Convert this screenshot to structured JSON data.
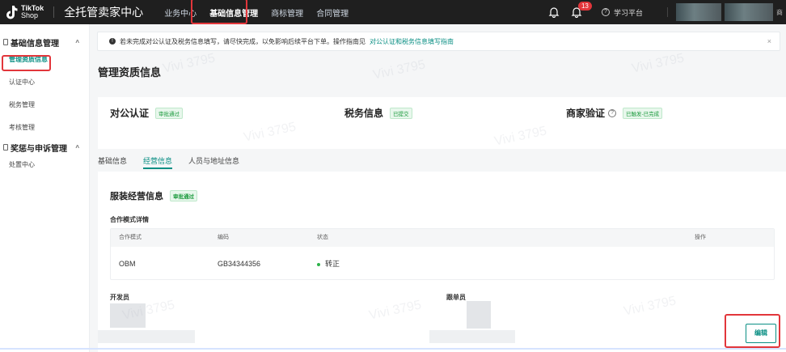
{
  "topbar": {
    "logo_line1": "TikTok",
    "logo_line2": "Shop",
    "brand": "全托管卖家中心",
    "nav": [
      "业务中心",
      "基础信息管理",
      "商标管理",
      "合同管理"
    ],
    "notification_count": "13",
    "help_label": "学习平台",
    "extra_text": "商"
  },
  "sidebar": {
    "group1": "基础信息管理",
    "items1": [
      "管理资质信息",
      "认证中心",
      "税务管理",
      "考核管理"
    ],
    "group2": "奖惩与申诉管理",
    "items2": [
      "处置中心"
    ]
  },
  "notice": {
    "text": "若未完成对公认证及税务信息填写，请尽快完成，以免影响后续平台下单。操作指南见",
    "link": "对公认证和税务信息填写指南"
  },
  "page": {
    "title": "管理资质信息"
  },
  "status": [
    {
      "label": "对公认证",
      "tag": "审批通过"
    },
    {
      "label": "税务信息",
      "tag": "已提交"
    },
    {
      "label": "商家验证",
      "tag": "已触发-已完成"
    }
  ],
  "tabs": [
    "基础信息",
    "经营信息",
    "人员与地址信息"
  ],
  "business": {
    "title": "服装经营信息",
    "tag": "审批通过",
    "subtitle": "合作模式详情",
    "columns": [
      "合作模式",
      "编码",
      "状态",
      "操作"
    ],
    "rows": [
      {
        "mode": "OBM",
        "code": "GB34344356",
        "status": "转正"
      }
    ],
    "developer_label": "开发员",
    "follower_label": "跟单员",
    "edit_label": "编辑"
  },
  "watermark": "Vivi 3795",
  "colors": {
    "accent": "#0b8f84",
    "topbar": "#1f1f1f",
    "highlight": "#e2363b",
    "success": "#2db34a"
  }
}
